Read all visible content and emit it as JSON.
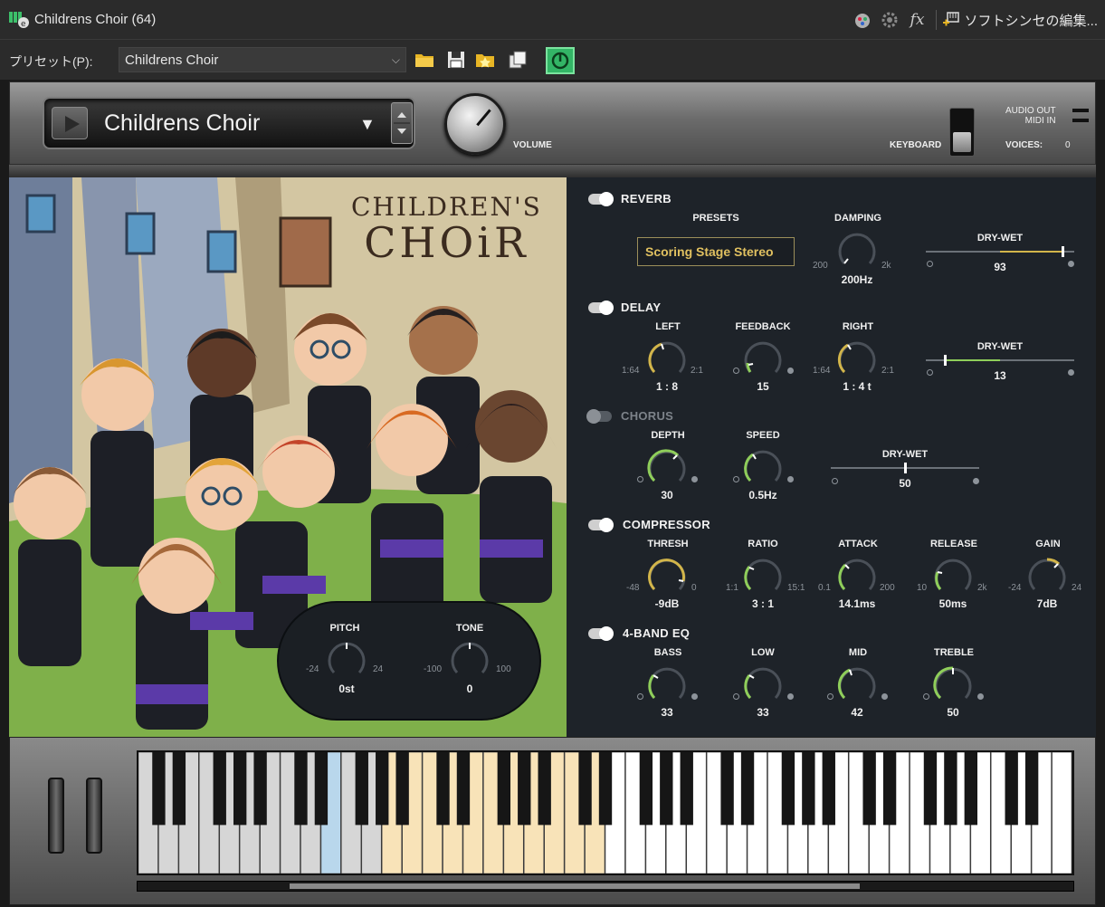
{
  "window": {
    "title": "Childrens Choir (64)",
    "edit_synth": "ソフトシンセの編集..."
  },
  "presetbar": {
    "label": "プリセット(P):",
    "value": "Childrens Choir"
  },
  "header": {
    "instrument": "Childrens Choir",
    "volume_label": "VOLUME",
    "keyboard_label": "KEYBOARD",
    "audio_out": "AUDIO OUT",
    "midi_in": "MIDI IN",
    "voices_label": "VOICES:",
    "voices_value": "0"
  },
  "artwork": {
    "title_line1": "CHILDREN'S",
    "title_line2": "CHOiR"
  },
  "pitch_tone": {
    "pitch": {
      "label": "PITCH",
      "value": "0st",
      "min": "-24",
      "max": "24"
    },
    "tone": {
      "label": "TONE",
      "value": "0",
      "min": "-100",
      "max": "100"
    }
  },
  "reverb": {
    "label": "REVERB",
    "presets_label": "PRESETS",
    "preset_value": "Scoring Stage Stereo",
    "damping": {
      "label": "DAMPING",
      "value": "200Hz",
      "min": "200",
      "max": "2k"
    },
    "drywet": {
      "label": "DRY-WET",
      "value": "93"
    }
  },
  "delay": {
    "label": "DELAY",
    "left": {
      "label": "LEFT",
      "value": "1 : 8",
      "min": "1:64",
      "max": "2:1"
    },
    "feedback": {
      "label": "FEEDBACK",
      "value": "15"
    },
    "right": {
      "label": "RIGHT",
      "value": "1 : 4 t",
      "min": "1:64",
      "max": "2:1"
    },
    "drywet": {
      "label": "DRY-WET",
      "value": "13"
    }
  },
  "chorus": {
    "label": "CHORUS",
    "depth": {
      "label": "DEPTH",
      "value": "30"
    },
    "speed": {
      "label": "SPEED",
      "value": "0.5Hz"
    },
    "drywet": {
      "label": "DRY-WET",
      "value": "50"
    }
  },
  "compressor": {
    "label": "COMPRESSOR",
    "thresh": {
      "label": "THRESH",
      "value": "-9dB",
      "min": "-48",
      "max": "0"
    },
    "ratio": {
      "label": "RATIO",
      "value": "3 : 1",
      "min": "1:1",
      "max": "15:1"
    },
    "attack": {
      "label": "ATTACK",
      "value": "14.1ms",
      "min": "0.1",
      "max": "200"
    },
    "release": {
      "label": "RELEASE",
      "value": "50ms",
      "min": "10",
      "max": "2k"
    },
    "gain": {
      "label": "GAIN",
      "value": "7dB",
      "min": "-24",
      "max": "24"
    }
  },
  "eq": {
    "label": "4-BAND EQ",
    "bass": {
      "label": "BASS",
      "value": "33"
    },
    "low": {
      "label": "LOW",
      "value": "33"
    },
    "mid": {
      "label": "MID",
      "value": "42"
    },
    "treble": {
      "label": "TREBLE",
      "value": "50"
    }
  },
  "colors": {
    "accent_yellow": "#d2b54a",
    "accent_green": "#8fce5a",
    "power_green": "#33b566"
  },
  "icons": [
    "folder-icon",
    "save-icon",
    "folder-star-icon",
    "copy-icon",
    "power-icon",
    "mixer-icon",
    "gear-icon",
    "fx-icon"
  ]
}
